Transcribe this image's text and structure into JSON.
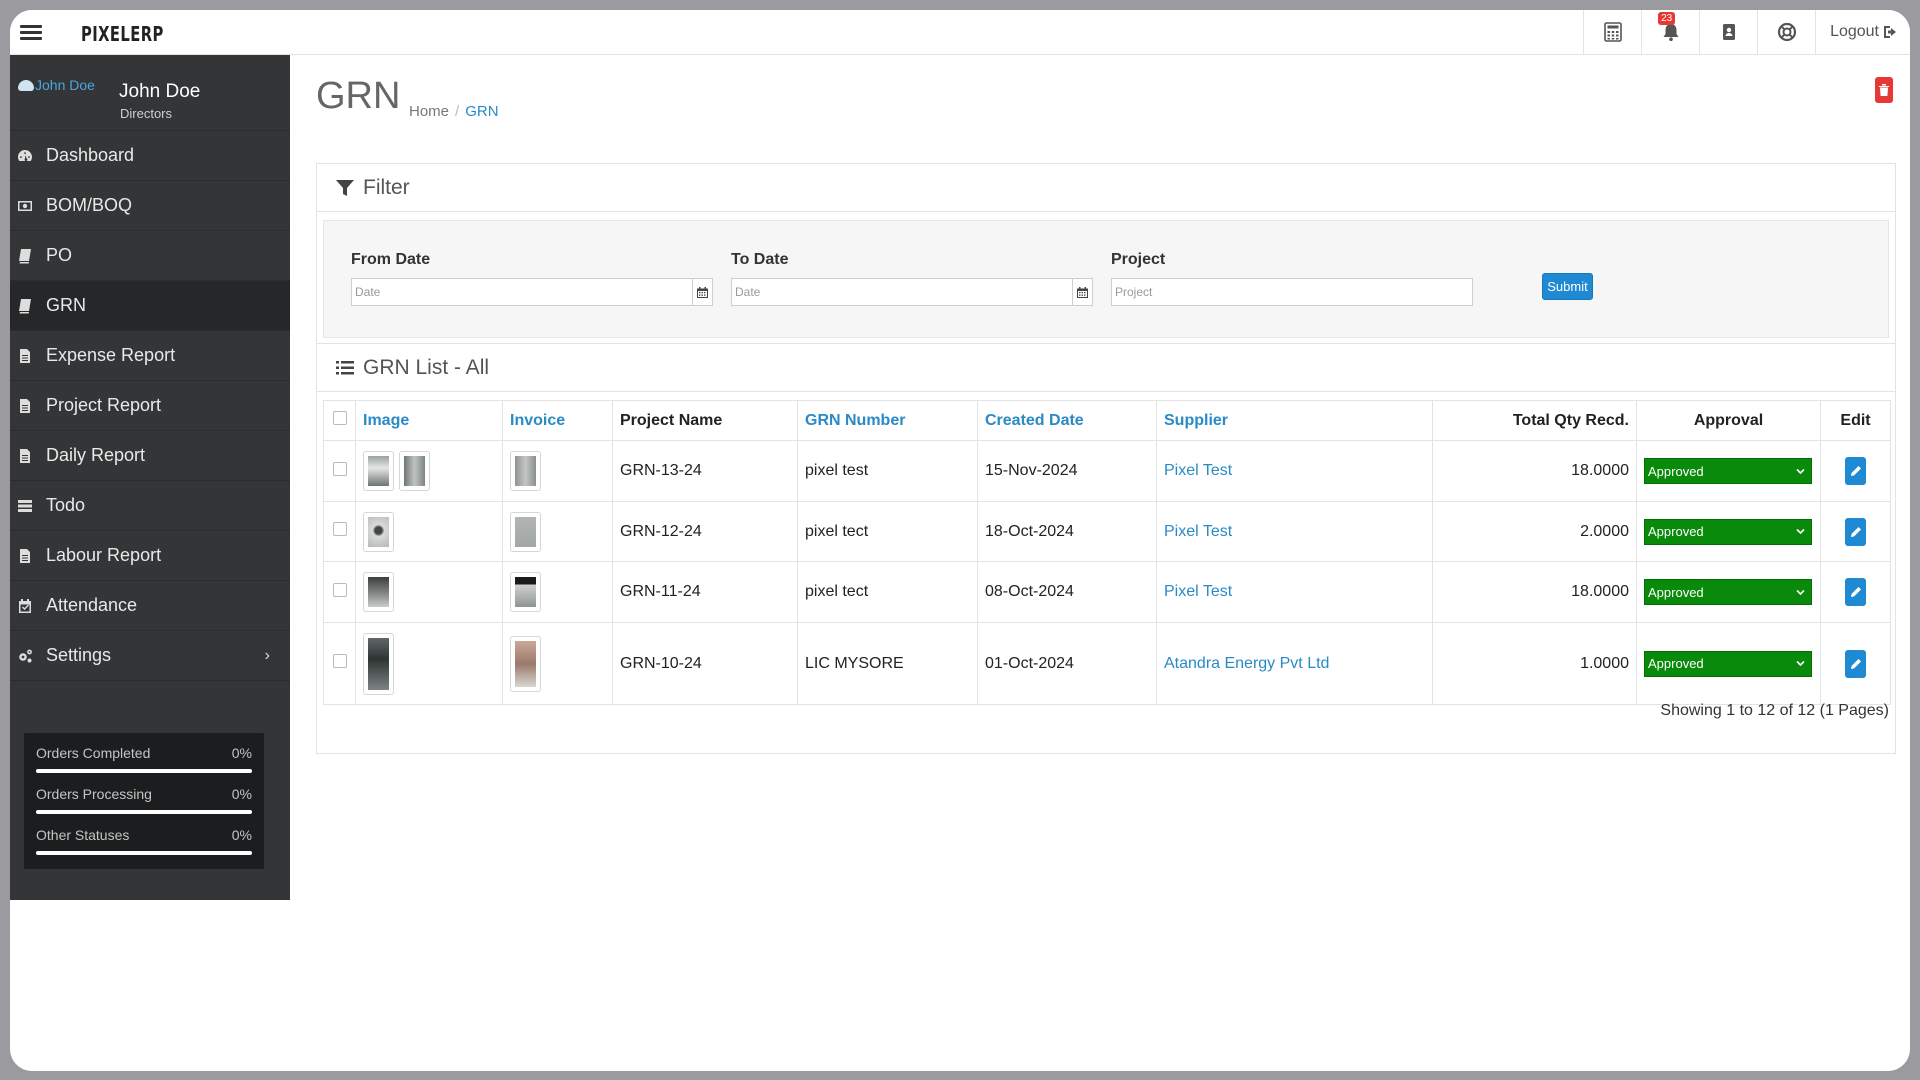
{
  "app": {
    "brand": "PIXELERP"
  },
  "topbar": {
    "notification_count": "23",
    "logout_label": "Logout"
  },
  "user": {
    "avatar_alt": "John Doe",
    "name": "John Doe",
    "role": "Directors"
  },
  "sidebar": {
    "items": [
      {
        "label": "Dashboard",
        "icon": "dashboard-icon"
      },
      {
        "label": "BOM/BOQ",
        "icon": "money-icon"
      },
      {
        "label": "PO",
        "icon": "book-icon"
      },
      {
        "label": "GRN",
        "icon": "book-icon",
        "active": true
      },
      {
        "label": "Expense Report",
        "icon": "file-icon"
      },
      {
        "label": "Project Report",
        "icon": "file-icon"
      },
      {
        "label": "Daily Report",
        "icon": "file-icon"
      },
      {
        "label": "Todo",
        "icon": "list-icon"
      },
      {
        "label": "Labour Report",
        "icon": "file-icon"
      },
      {
        "label": "Attendance",
        "icon": "calendar-check-icon"
      },
      {
        "label": "Settings",
        "icon": "cogs-icon",
        "chevron": "›"
      }
    ],
    "stats": [
      {
        "label": "Orders Completed",
        "value": "0%",
        "progress": 0
      },
      {
        "label": "Orders Processing",
        "value": "0%",
        "progress": 0
      },
      {
        "label": "Other Statuses",
        "value": "0%",
        "progress": 0
      }
    ]
  },
  "page": {
    "title": "GRN",
    "breadcrumb": {
      "home": "Home",
      "sep": "/",
      "current": "GRN"
    }
  },
  "filter": {
    "title": "Filter",
    "from_label": "From Date",
    "from_placeholder": "Date",
    "to_label": "To Date",
    "to_placeholder": "Date",
    "project_label": "Project",
    "project_placeholder": "Project",
    "submit_label": "Submit"
  },
  "list": {
    "title": "GRN List - All",
    "columns": {
      "image": "Image",
      "invoice": "Invoice",
      "project": "Project Name",
      "grn": "GRN Number",
      "created": "Created Date",
      "supplier": "Supplier",
      "qty": "Total Qty Recd.",
      "approval": "Approval",
      "edit": "Edit"
    },
    "rows": [
      {
        "project": "GRN-13-24",
        "grn": "pixel test",
        "created": "15-Nov-2024",
        "supplier": "Pixel Test",
        "qty": "18.0000",
        "approval": "Approved"
      },
      {
        "project": "GRN-12-24",
        "grn": "pixel tect",
        "created": "18-Oct-2024",
        "supplier": "Pixel Test",
        "qty": "2.0000",
        "approval": "Approved"
      },
      {
        "project": "GRN-11-24",
        "grn": "pixel tect",
        "created": "08-Oct-2024",
        "supplier": "Pixel Test",
        "qty": "18.0000",
        "approval": "Approved"
      },
      {
        "project": "GRN-10-24",
        "grn": "LIC MYSORE",
        "created": "01-Oct-2024",
        "supplier": "Atandra Energy Pvt Ltd",
        "qty": "1.0000",
        "approval": "Approved"
      }
    ],
    "showing": "Showing 1 to 12 of 12 (1 Pages)"
  },
  "colors": {
    "accent": "#2a8ac6",
    "approved": "#0a8a0a",
    "sidebar": "#333537",
    "danger": "#e53935"
  }
}
